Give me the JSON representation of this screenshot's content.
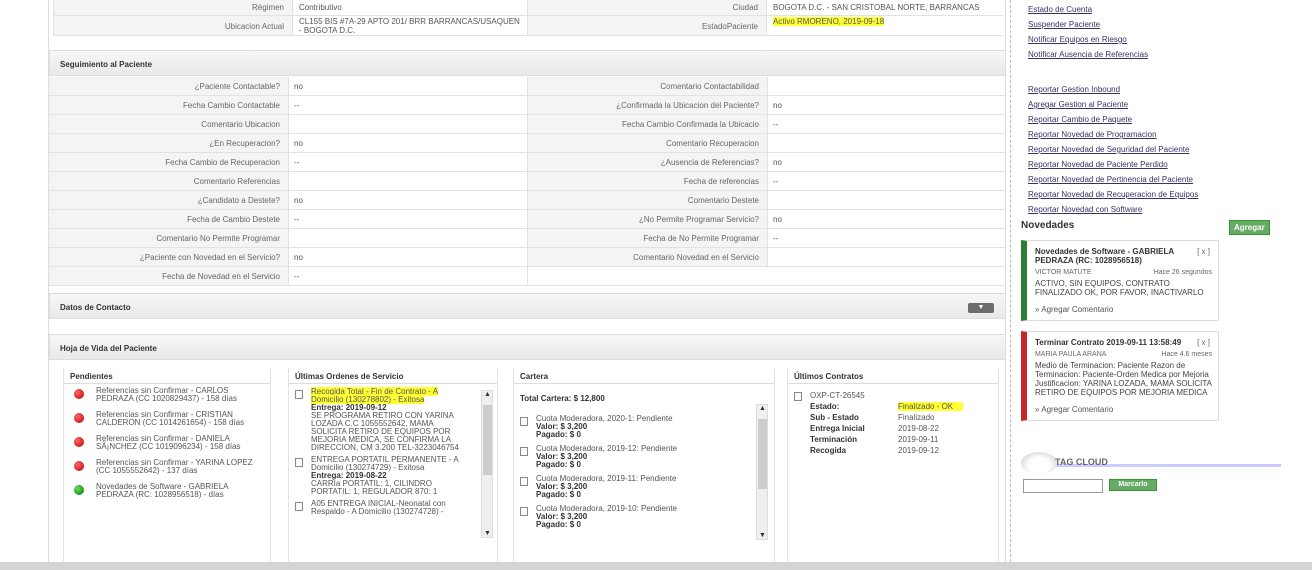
{
  "top": {
    "rows": [
      {
        "l1": "Régimen",
        "v1": "Contributivo",
        "l2": "Ciudad",
        "v2": "BOGOTA D.C. - SAN CRISTOBAL NORTE, BARRANCAS"
      },
      {
        "l1": "Ubicacion Actual",
        "v1": "CL155 BIS #7A-29 APTO 201/ BRR BARRANCAS/USAQUEN - BOGOTA D.C.",
        "l2": "EstadoPaciente",
        "v2": "Activo RMORENO, 2019-09-18"
      }
    ]
  },
  "seguimiento": {
    "title": "Seguimiento al Paciente",
    "rows": [
      {
        "l1": "¿Paciente Contactable?",
        "v1": "no",
        "l2": "Comentario Contactabilidad",
        "v2": ""
      },
      {
        "l1": "Fecha Cambio Contactable",
        "v1": "--",
        "l2": "¿Confirmada la Ubicacion del Paciente?",
        "v2": "no"
      },
      {
        "l1": "Comentario Ubicacion",
        "v1": "",
        "l2": "Fecha Cambio Confirmada la Ubicacio",
        "v2": "--"
      },
      {
        "l1": "¿En Recuperacion?",
        "v1": "no",
        "l2": "Comentario Recuperacion",
        "v2": ""
      },
      {
        "l1": "Fecha Cambio de Recuperacion",
        "v1": "--",
        "l2": "¿Ausencia de Referencias?",
        "v2": "no"
      },
      {
        "l1": "Comentario Referencias",
        "v1": "",
        "l2": "Fecha de referencias",
        "v2": "--"
      },
      {
        "l1": "¿Candidato a Destete?",
        "v1": "no",
        "l2": "Comentario Destete",
        "v2": ""
      },
      {
        "l1": "Fecha de Cambio Destete",
        "v1": "--",
        "l2": "¿No Permite Programar Servicio?",
        "v2": "no"
      },
      {
        "l1": "Comentario No Permite Programar",
        "v1": "",
        "l2": "Fecha de No Permite Programar",
        "v2": "--"
      },
      {
        "l1": "¿Paciente con Novedad en el Servicio?",
        "v1": "no",
        "l2": "Comentario Novedad en el Servicio",
        "v2": ""
      },
      {
        "l1": "Fecha de Novedad en el Servicio",
        "v1": "--",
        "l2": "",
        "v2": ""
      }
    ]
  },
  "datos_contacto": {
    "title": "Datos de Contacto",
    "toggle": "▼"
  },
  "hoja_vida": {
    "title": "Hoja de Vida del Paciente",
    "pendientes": {
      "title": "Pendientes",
      "items": [
        {
          "text": "Referencias sin Confirmar - CARLOS PEDRAZA (CC 1020829437) - 158 días",
          "status": "red"
        },
        {
          "text": "Referencias sin Confirmar - CRISTIAN CALDERON (CC 1014261654) - 158 días",
          "status": "red"
        },
        {
          "text": "Referencias sin Confirmar - DANIELA SÃ¡NCHEZ (CC 1019096234) - 158 días",
          "status": "red"
        },
        {
          "text": "Referencias sin Confirmar - YARINA LOPEZ (CC 1055552642) - 137 días",
          "status": "red"
        },
        {
          "text": "Novedades de Software - GABRIELA PEDRAZA (RC: 1028956518) - días",
          "status": "green"
        }
      ]
    },
    "ordenes": {
      "title": "Últimas Ordenes de Servicio",
      "items": [
        {
          "head": "Recogida Total - Fin de Contrato - A Domicilio (130278802) - Exitosa",
          "entrega_label": "Entrega:",
          "entrega": "2019-09-12",
          "detail": "SE PROGRAMA RETIRO CON YARINA LOZADA C.C 1055552642, MAMA SOLICITA RETIRO DE EQUIPOS POR MEJORIA MEDICA, SE CONFIRMA LA DIRECCION, CM 3.200 TEL-3223046754"
        },
        {
          "head": "ENTREGA PORTATIL PERMANENTE - A Domicilio (130274729) - Exitosa",
          "entrega_label": "Entrega:",
          "entrega": "2019-08-22",
          "detail": "CARRIa PORTATIL: 1, CILINDRO PORTATIL: 1, REGULADOR 870: 1"
        },
        {
          "head": "A05 ENTREGA INICIAL-Neonatal con Respaldo - A Domicilio (130274728) -",
          "entrega_label": "",
          "entrega": "",
          "detail": ""
        }
      ],
      "scroll_up": "▲",
      "scroll_down": "▼"
    },
    "cartera": {
      "title": "Cartera",
      "total": "Total Cartera: $ 12,800",
      "items": [
        {
          "desc": "Cuota Moderadora, 2020-1: Pendiente",
          "valor_label": "Valor:",
          "valor": "$ 3,200",
          "pagado_label": "Pagado:",
          "pagado": "$ 0"
        },
        {
          "desc": "Cuota Moderadora, 2019-12: Pendiente",
          "valor_label": "Valor:",
          "valor": "$ 3,200",
          "pagado_label": "Pagado:",
          "pagado": "$ 0"
        },
        {
          "desc": "Cuota Moderadora, 2019-11: Pendiente",
          "valor_label": "Valor:",
          "valor": "$ 3,200",
          "pagado_label": "Pagado:",
          "pagado": "$ 0"
        },
        {
          "desc": "Cuota Moderadora, 2019-10: Pendiente",
          "valor_label": "Valor:",
          "valor": "$ 3,200",
          "pagado_label": "Pagado:",
          "pagado": "$ 0"
        }
      ],
      "scroll_up": "▲",
      "scroll_down": "▼"
    },
    "contratos": {
      "title": "Últimos Contratos",
      "id": "OXP-CT-26545",
      "fields": [
        {
          "k": "Estado:",
          "v": "Finalizado - OK"
        },
        {
          "k": "Sub - Estado",
          "v": "Finalizado"
        },
        {
          "k": "Entrega Inicial",
          "v": "2019-08-22"
        },
        {
          "k": "Terminación",
          "v": "2019-09-11"
        },
        {
          "k": "Recogida",
          "v": "2019-09-12"
        }
      ]
    }
  },
  "sidebar": {
    "links_top": [
      "Estado de Cuenta",
      "Suspender Paciente",
      "Notificar Equipos en Riesgo",
      "Notificar Ausencia de Referencias"
    ],
    "links_bottom": [
      "Reportar Gestion Inbound",
      "Agregar Gestion al Paciente",
      "Reportar Cambio de Paquete",
      "Reportar Novedad de Programacion",
      "Reportar Novedad de Seguridad del Paciente",
      "Reportar Novedad de Paciente Perdido",
      "Reportar Novedad de Pertinencia del Paciente",
      "Reportar Novedad de Recuperacion de Equipos",
      "Reportar Novedad con Software"
    ],
    "novedades_title": "Novedades",
    "agregar": "Agregar",
    "cards": [
      {
        "title": "Novedades de Software - GABRIELA PEDRAZA (RC: 1028956518)",
        "close": "[ x ]",
        "author": "VICTOR MATUTE",
        "time": "Hace 26 segundos",
        "body": "ACTIVO, SIN EQUIPOS, CONTRATO FINALIZADO OK, POR FAVOR, INACTIVARLO",
        "comment": "» Agregar Comentario",
        "color": "#2e7d32"
      },
      {
        "title": "Terminar Contrato 2019-09-11 13:58:49",
        "close": "[ x ]",
        "author": "MARIA PAULA ARANA",
        "time": "Hace 4.6 meses",
        "body": "Medio de Terminacion: Paciente Razon de Terminacion: Paciente-Orden Medica por Mejoria Justificacion: YARINA LOZADA, MAMA SOLICITA RETIRO DE EQUIPOS POR MEJORIA MEDICA",
        "comment": "» Agregar Comentario",
        "color": "#c62828"
      }
    ],
    "tagcloud": {
      "label": "TAG CLOUD",
      "button": "Marcarlo",
      "input_value": ""
    }
  }
}
